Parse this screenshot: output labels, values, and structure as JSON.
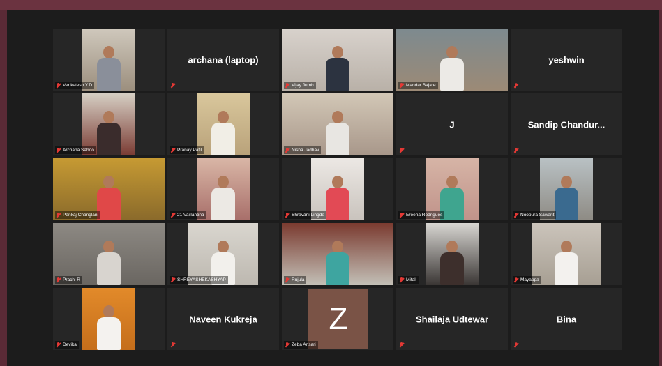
{
  "meeting": {
    "participants": [
      {
        "name": "Venkatesh Y.D",
        "type": "video",
        "video": "narrow",
        "c1": "#cfc8bc",
        "c2": "#9c8f7e",
        "shirt": "#8a8f9a"
      },
      {
        "name": "archana (laptop)",
        "type": "text"
      },
      {
        "name": "Vijay Jumb",
        "type": "video",
        "video": "full",
        "c1": "#d8d2cc",
        "c2": "#b9b1a8",
        "shirt": "#2c3340"
      },
      {
        "name": "Mandar Bajare",
        "type": "video",
        "video": "full",
        "c1": "#7d8a8f",
        "c2": "#9c8a76",
        "shirt": "#eceae6"
      },
      {
        "name": "yeshwin",
        "type": "text"
      },
      {
        "name": "Archana Sahoo",
        "type": "video",
        "video": "narrow",
        "c1": "#d6cfc4",
        "c2": "#7a3b33",
        "shirt": "#3a2c2c"
      },
      {
        "name": "Pranay Patil",
        "type": "video",
        "video": "narrow",
        "c1": "#d9c79c",
        "c2": "#b9a27a",
        "shirt": "#f1eee6"
      },
      {
        "name": "Nisha Jadhav",
        "type": "video",
        "video": "full",
        "c1": "#d2c7b6",
        "c2": "#a8978a",
        "shirt": "#e8e6e2"
      },
      {
        "name": "J",
        "type": "text"
      },
      {
        "name": "Sandip Chandur...",
        "type": "text"
      },
      {
        "name": "Pankaj Changlani",
        "type": "video",
        "video": "full",
        "active": true,
        "c1": "#c69a33",
        "c2": "#8a6a2b",
        "shirt": "#e04848"
      },
      {
        "name": "21 Vaiilantina",
        "type": "video",
        "video": "narrow",
        "c1": "#d9b6a6",
        "c2": "#a86f6a",
        "shirt": "#ece9e4"
      },
      {
        "name": "Shravani Lingde",
        "type": "video",
        "video": "narrow",
        "c1": "#ece8e4",
        "c2": "#c9c3bd",
        "shirt": "#e24a55"
      },
      {
        "name": "Ereena Rodrigues",
        "type": "video",
        "video": "narrow",
        "c1": "#d6b4a6",
        "c2": "#c0938a",
        "shirt": "#3fa58f"
      },
      {
        "name": "Noopura Sawant",
        "type": "video",
        "video": "narrow",
        "c1": "#b9c1c4",
        "c2": "#8e8b84",
        "shirt": "#3a6a8f"
      },
      {
        "name": "Prachi R",
        "type": "video",
        "video": "full",
        "c1": "#8d8983",
        "c2": "#6a6661",
        "shirt": "#d8d4cf"
      },
      {
        "name": "SHREYASHEKASHYAP",
        "type": "video",
        "video": "center",
        "c1": "#d9d6cf",
        "c2": "#bdb8b0",
        "shirt": "#f2f0ec"
      },
      {
        "name": "Rujula",
        "type": "video",
        "video": "full",
        "c1": "#7a3a2f",
        "c2": "#c3c0b7",
        "shirt": "#3ea5a0"
      },
      {
        "name": "Mitali",
        "type": "video",
        "video": "narrow",
        "c1": "#d8d6d2",
        "c2": "#3a3634",
        "shirt": "#3d2f2c"
      },
      {
        "name": "Mayappa",
        "type": "video",
        "video": "center",
        "c1": "#cbc4bb",
        "c2": "#a79f93",
        "shirt": "#f3f1ee"
      },
      {
        "name": "Devika",
        "type": "video",
        "video": "narrow",
        "c1": "#e28a2a",
        "c2": "#c56e1b",
        "shirt": "#f4f2ef"
      },
      {
        "name": "Naveen Kukreja",
        "type": "text"
      },
      {
        "name": "Zeba Ansari",
        "type": "avatar",
        "initial": "Z"
      },
      {
        "name": "Shailaja Udtewar",
        "type": "text"
      },
      {
        "name": "Bina",
        "type": "text"
      }
    ]
  }
}
